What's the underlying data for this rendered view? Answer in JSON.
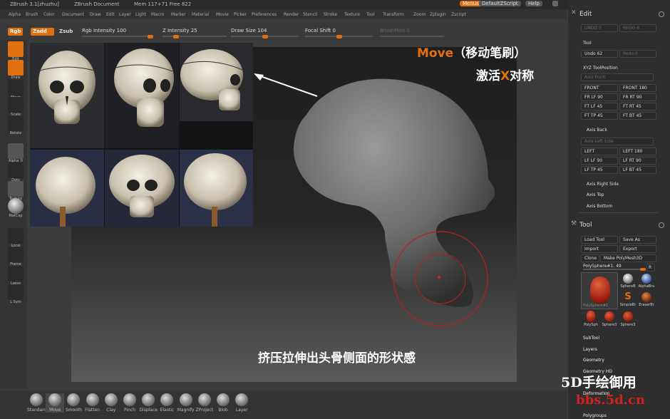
{
  "titlebar": {
    "app": "ZBrush 3.1[zhuzhu]",
    "doc": "ZBrush Document",
    "mem": "Mem 117+71 Free 822",
    "menus": "Menus",
    "script": "DefaultZScript",
    "help": "Help"
  },
  "menu": [
    "Alpha",
    "Brush",
    "Color",
    "Document",
    "Draw",
    "Edit",
    "Layer",
    "Light",
    "Macro",
    "Marker",
    "Material",
    "Movie",
    "Picker",
    "Preferences",
    "Render",
    "Stencil",
    "Stroke",
    "Texture",
    "Tool",
    "Transform",
    "Zoom",
    "Zplugin",
    "Zscript"
  ],
  "toolbar": {
    "rgb": "Rgb",
    "zadd": "Zadd",
    "zsub": "Zsub",
    "rgb_intensity": "Rgb Intensity 100",
    "z_intensity": "Z Intensity 25",
    "draw_size": "Draw Size 104",
    "focal_shift": "Focal Shift 0",
    "brushmod": "BrushMod 0"
  },
  "left_tools": [
    "Edit",
    "Draw",
    "Move",
    "Scale",
    "Rotate",
    "Alpha_0",
    "Dots",
    "Texture",
    "MatCap",
    "Local",
    "Frame",
    "Lasso",
    "L.Sym"
  ],
  "annotations": {
    "line1_a": "Move",
    "line1_b": "（移动笔刷）",
    "line2_a": "激活",
    "line2_x": "X",
    "line2_b": "对称",
    "bottom": "挤压拉伸出头骨侧面的形状感"
  },
  "brushes": [
    "Standard",
    "Move",
    "Smooth",
    "Flatten",
    "Clay",
    "Pinch",
    "Displace",
    "Elastic",
    "Magnify",
    "ZProject",
    "Blob",
    "Layer"
  ],
  "edit_panel": {
    "title": "Edit",
    "undo": "UNDO 5",
    "redo": "REDO 6",
    "tool": "Tool",
    "undo2": "Undo 62",
    "redo2": "Redo 0"
  },
  "xyz": {
    "title": "XYZ ToolPosition",
    "axis_front": "Axis Front",
    "front": "FRONT",
    "front180": "FRONT 180",
    "frlf90": "FR LF 90",
    "frrt90": "FR RT 90",
    "ftlf45": "FT LF 45",
    "ftrt45": "FT RT 45",
    "fttp45": "FT TP 45",
    "ftbt45": "FT BT 45",
    "axis_back": "Axis Back",
    "axis_left": "Axis Left Side",
    "left": "LEFT",
    "left180": "LEFT 180",
    "lflf90": "LF LF 90",
    "lfrt90": "LF RT 90",
    "lftp45": "LF TP 45",
    "lfbt45": "LF BT 45",
    "axis_right": "Axis Right Side",
    "axis_top": "Axis Top",
    "axis_bottom": "Axis Bottom"
  },
  "tool_panel": {
    "title": "Tool",
    "load": "Load Tool",
    "save": "Save As",
    "import": "Import",
    "export": "Export",
    "clone": "Clone",
    "make": "Make PolyMesh3D",
    "current": "PolySphere#1. 49",
    "r": "R",
    "thumbs": [
      "PolySphere#1",
      "SphereB",
      "AlphaBru",
      "SimpleBr",
      "EraserBr",
      "PolySph",
      "Sphere3",
      "Sphere3"
    ],
    "sections": [
      "SubTool",
      "Layers",
      "Geometry",
      "Geometry HD",
      "Deformation",
      "Polygroups"
    ]
  },
  "watermark": {
    "line1": "5D手绘御用",
    "line2": "bbs.5d.cn"
  }
}
